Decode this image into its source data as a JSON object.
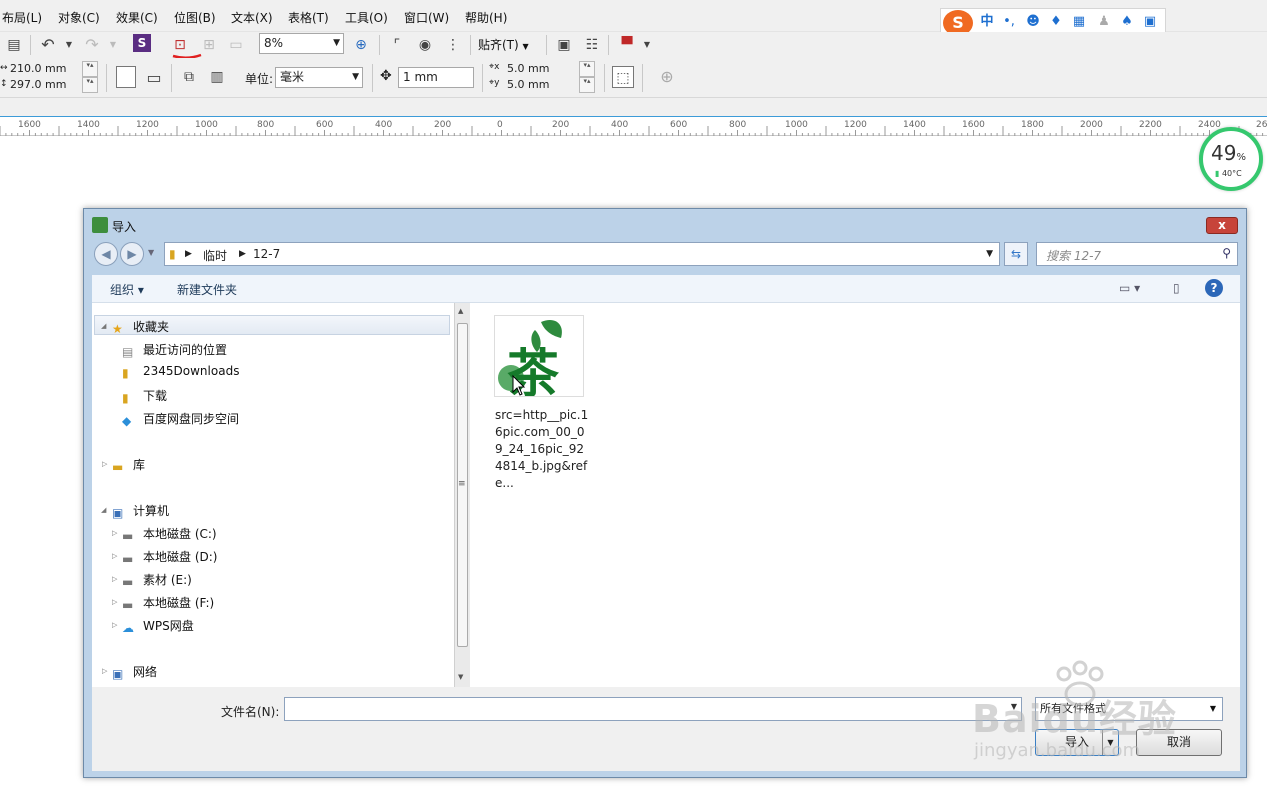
{
  "menu": [
    "布局(L)",
    "对象(C)",
    "效果(C)",
    "位图(B)",
    "文本(X)",
    "表格(T)",
    "工具(O)",
    "窗口(W)",
    "帮助(H)"
  ],
  "ime": {
    "logo": "S",
    "chinese": "中",
    "punct": "•,"
  },
  "toolbar1": {
    "zoom": "8%",
    "snap": "贴齐(T)"
  },
  "toolbar2": {
    "width": "210.0 mm",
    "height": "297.0 mm",
    "units_label": "单位:",
    "units": "毫米",
    "nudge": "1 mm",
    "dup_x": "5.0 mm",
    "dup_y": "5.0 mm"
  },
  "ruler": [
    "1600",
    "1400",
    "1200",
    "1000",
    "800",
    "600",
    "400",
    "200",
    "0",
    "200",
    "400",
    "600",
    "800",
    "1000",
    "1200",
    "1400",
    "1600",
    "1800",
    "2000",
    "2200",
    "2400",
    "26"
  ],
  "meter": {
    "value": "49",
    "unit": "%",
    "temp": "40°C"
  },
  "dialog": {
    "title": "导入",
    "close": "x",
    "breadcrumb": [
      "临时",
      "12-7"
    ],
    "search_placeholder": "搜索 12-7",
    "organize": "组织 ▾",
    "new_folder": "新建文件夹",
    "favorites": "收藏夹",
    "fav_items": [
      "最近访问的位置",
      "2345Downloads",
      "下载",
      "百度网盘同步空间"
    ],
    "library": "库",
    "computer": "计算机",
    "drives": [
      "本地磁盘 (C:)",
      "本地磁盘 (D:)",
      "素材 (E:)",
      "本地磁盘 (F:)",
      "WPS网盘"
    ],
    "network": "网络",
    "file_thumb_char": "茶",
    "file_name": "src=http__pic.16pic.com_00_09_24_16pic_924814_b.jpg&refe...",
    "filename_label": "文件名(N):",
    "filename_value": "",
    "filter": "所有文件格式",
    "import_btn": "导入",
    "cancel_btn": "取消"
  },
  "watermark": {
    "brand": "Baidu经验",
    "url": "jingyan.baidu.com"
  }
}
